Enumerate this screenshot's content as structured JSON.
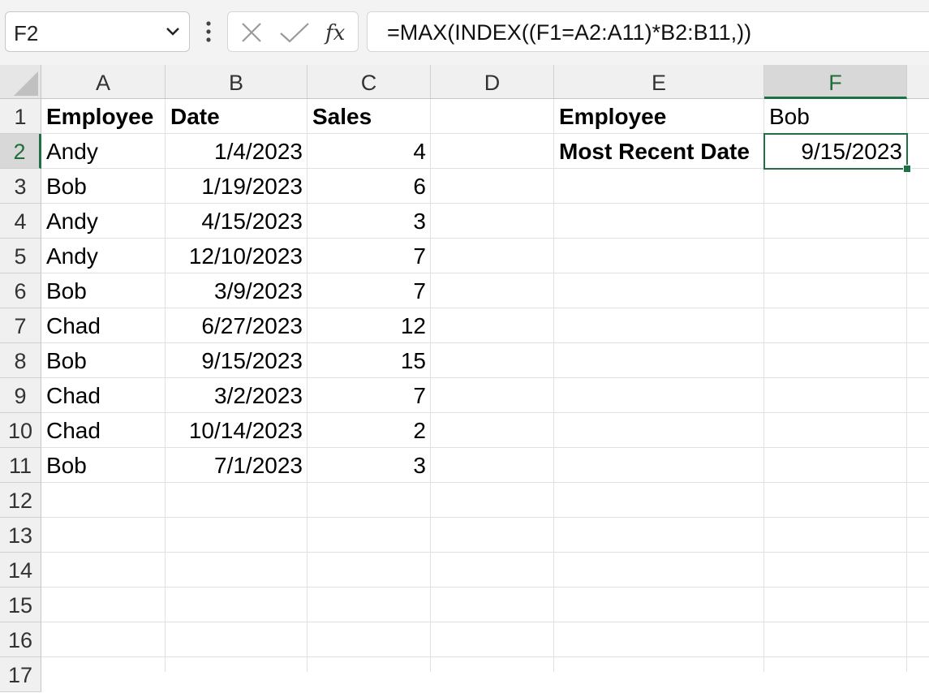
{
  "name_box": {
    "value": "F2"
  },
  "formula_bar": {
    "formula": "=MAX(INDEX((F1=A2:A11)*B2:B11,))"
  },
  "icons": {
    "name_box_dropdown": "chevron-down-icon",
    "more": "vertical-dots-icon",
    "cancel": "x-icon",
    "enter": "check-icon",
    "function": "fx-icon"
  },
  "columns": [
    "A",
    "B",
    "C",
    "D",
    "E",
    "F"
  ],
  "rows": [
    "1",
    "2",
    "3",
    "4",
    "5",
    "6",
    "7",
    "8",
    "9",
    "10",
    "11",
    "12",
    "13",
    "14",
    "15",
    "16",
    "17"
  ],
  "selected_cell": {
    "column": "F",
    "row": "2"
  },
  "table": {
    "headers": [
      "Employee",
      "Date",
      "Sales"
    ],
    "rows": [
      [
        "Andy",
        "1/4/2023",
        "4"
      ],
      [
        "Bob",
        "1/19/2023",
        "6"
      ],
      [
        "Andy",
        "4/15/2023",
        "3"
      ],
      [
        "Andy",
        "12/10/2023",
        "7"
      ],
      [
        "Bob",
        "3/9/2023",
        "7"
      ],
      [
        "Chad",
        "6/27/2023",
        "12"
      ],
      [
        "Bob",
        "9/15/2023",
        "15"
      ],
      [
        "Chad",
        "3/2/2023",
        "7"
      ],
      [
        "Chad",
        "10/14/2023",
        "2"
      ],
      [
        "Bob",
        "7/1/2023",
        "3"
      ]
    ]
  },
  "lookup": {
    "employee_label": "Employee",
    "employee_value": "Bob",
    "result_label": "Most Recent Date",
    "result_value": "9/15/2023"
  },
  "colors": {
    "accent": "#1e7145"
  }
}
